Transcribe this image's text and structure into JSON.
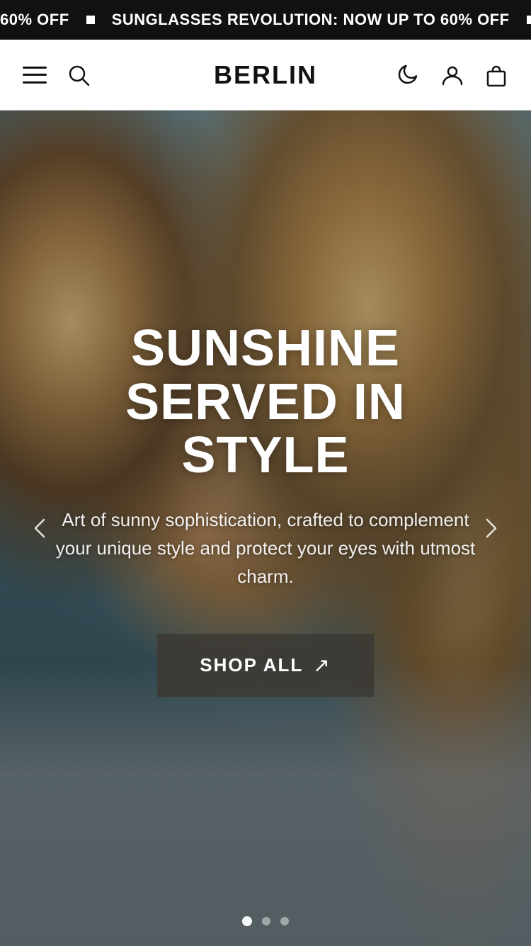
{
  "announcement": {
    "texts": [
      "60% OFF",
      "SUNGLASSES REVOLUTION: NOW UP TO 60% OFF",
      "60% OFF",
      "SUNGLASSES REVOLUTION: NOW UP TO 60% OFF"
    ],
    "combined": "60% OFF  ■  SUNGLASSES REVOLUTION: NOW UP TO 60% OFF  ■  60% OFF  ■  SUNGLASSES REVOLUTION: NOW UP TO 60% OFF"
  },
  "header": {
    "logo": "BERLIN",
    "menu_label": "Menu",
    "search_label": "Search",
    "dark_mode_label": "Dark Mode",
    "account_label": "Account",
    "cart_label": "Cart"
  },
  "hero": {
    "title": "SUNSHINE SERVED IN STYLE",
    "subtitle": "Art of sunny sophistication, crafted to complement your unique style and protect your eyes with utmost charm.",
    "cta_label": "SHOP ALL",
    "cta_arrow": "↗",
    "prev_label": "Previous",
    "next_label": "Next"
  },
  "carousel": {
    "total_slides": 3,
    "active_slide": 1
  },
  "colors": {
    "announcement_bg": "#111111",
    "header_bg": "#ffffff",
    "cta_bg": "rgba(60,57,52,0.88)",
    "accent": "#ffffff"
  }
}
